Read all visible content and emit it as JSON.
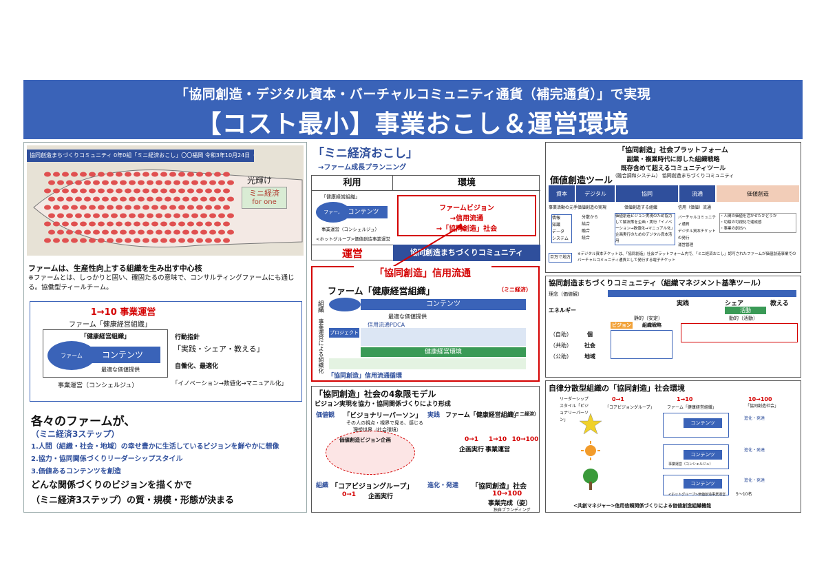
{
  "header": {
    "line1": "「協同創造・デジタル資本・バーチャルコミュニティ通貨（補完通貨）」で実現",
    "line2": "【コスト最小】事業おこし＆運営環境"
  },
  "left": {
    "caption": "協同創造まちづくりコミュニティ 0年0組「ミニ経済おこし」〇〇福岡 令和3年10月24日（日）",
    "fish_label1": "光輝け",
    "fish_label2": "ミニ経済",
    "fish_label3": "for one",
    "farm_heading": "ファームは、生産性向上する組織を生み出す中心核",
    "farm_note": "※ファームとは、しっかりと固い、確固たるの意味で、コンサルティングファームにも通じる。協働型ティールチーム。",
    "diagram_title": "1→10 事業運営",
    "diagram_sub": "ファーム「健康経営組織」",
    "org_label": "「健康経営組織」",
    "farm_oval": "ファーム",
    "contents": "コンテンツ",
    "value": "最適な価値提供",
    "op": "事業運営（コンシェルジュ）",
    "guide_title": "行動指針",
    "guide_text": "「実践・シェア・教える」",
    "auto_title": "自働化、最適化",
    "auto_text": "「イノベーション→数値化→マニュアル化」",
    "bottom_title": "各々のファームが、",
    "bottom_sub": "（ミニ経済3ステップ）",
    "step1": "1.人間（組織・社会・地域）の幸せ豊かに生活しているビジョンを鮮やかに想像",
    "step2": "2.協力・協同関係づくりリーダーシップスタイル",
    "step3": "3.価値あるコンテンツを創造",
    "conclude1": "どんな関係づくりのビジョンを描くかで",
    "conclude2": "（ミニ経済3ステップ）の質・規模・形態が決まる"
  },
  "middle": {
    "title": "「ミニ経済おこし」",
    "subtitle": "→ファーム成長プランニング",
    "col_use": "利用",
    "col_env": "環境",
    "farm": "ファーム",
    "contents": "コンテンツ",
    "org": "「健康経営組織」",
    "op": "事業運営（コンシェルジュ）",
    "hot": "<ホットグループ>価値創造事業運営",
    "vision1": "ファームビジョン",
    "vision2": "→信用流通",
    "vision3": "→「協同創造」社会",
    "unei": "運営",
    "community": "協同創造まちづくりコミュニティ",
    "credit_title": "「協同創造」信用流通",
    "credit_farm": "ファーム「健康経営組織」",
    "credit_mini": "（ミニ経済）",
    "side_label": "組織",
    "side_label2": "事業運営による組織化",
    "credit_contents": "コンテンツ",
    "credit_value": "最適な価値提供",
    "credit_pdca": "信用流通PDCA",
    "credit_project": "プロジェクト",
    "credit_env": "健康経営環境",
    "credit_foot": "「協同創造」信用流通循環",
    "model_title": "「協同創造」社会の4象限モデル",
    "model_sub": "ビジョン実現を協力・協同関係づくりにより形成",
    "q1_label": "価値観",
    "q1_title": "「ビジョナリーパーソン」",
    "q1_text1": "その人の視点・視界で見る、感じる",
    "q1_text2": "理想世界（社会環境）",
    "q2_label": "実践",
    "q2_title": "ファーム「健康経営組織」",
    "q2_mini": "（ミニ経済）",
    "q3_label": "組織",
    "q3_title": "「コアビジョングループ」",
    "q4_label": "進化・発達",
    "q4_title": "「協同創造」社会",
    "vision_plan": "価値創造ビジョン企画",
    "s1": "0→1",
    "s1b": "企画実行",
    "s2": "1→10",
    "s2b": "事業運営",
    "s3": "10→100",
    "s3b": "事業完成（姿）",
    "s3c": "独自ブランディング"
  },
  "right": {
    "platform_title": "「協同創造」社会プラットフォーム",
    "platform_sub1": "副業・複業時代に即した組織戦略",
    "platform_sub2": "既存含めて超えるコミュニティツール",
    "platform_sub3": "（融合調和システム） 協同創造まちづくりコミュニティ",
    "tool_title": "価値創造ツール",
    "tool_cols": [
      "資本",
      "デジタル",
      "協同",
      "流通",
      "価値創造"
    ],
    "tool_r1": [
      "事業活動の元手",
      "価値創造の実現",
      "価値創造する組織",
      "信用（価値）流通",
      ""
    ],
    "tool_cell1": "情報\n知識\nデータ\nシステム",
    "tool_cell2": "分散から\n結合\n融合\n統合",
    "tool_cell3": "価値創造ビジョン実現のため協力して解決策を企画・実行「イノベーション→数値化→マニュアル化」企画実行のためのデジタル資本活用",
    "tool_cell4": "バーチャルコミュニティ通貨\nデジタル資本チケットの発行\n運営管理",
    "tool_cell5": "・人間の価値を活かせたかどうか\n・功績の可視化で達成感\n・事業の創出へ",
    "tool_foot_label": "巨万で地方",
    "tool_foot": "※デジタル資本チケットは、「協同創造」社会プラットフォーム内で、「ミニ経済おこし」認可されたファームが価値創造事業でのバーチャルコミュニティ通貨として発行する電子チケット",
    "community_title": "協同創造まちづくりコミュニティ（組織マネジメント基準ツール）",
    "comm_r1": "理念（価値観）",
    "comm_r2": "エネルギー",
    "comm_practice": "実践",
    "comm_share": "シェア",
    "comm_teach": "教える",
    "comm_act": "活動",
    "comm_still": "静的（安定）",
    "comm_move": "動的（活動）",
    "comm_vision": "ビジョン",
    "comm_strategy": "組織戦略",
    "comm_tags": [
      "（自助）",
      "（共助）",
      "（公助）"
    ],
    "comm_nodes": [
      "個",
      "社会",
      "地域"
    ],
    "auto_title": "自律分散型組織の「協同創造」社会環境",
    "auto_leader": "リーダーシップスタイル「ビジョナリーパーソン」",
    "auto_s1": "0→1",
    "auto_core": "「コアビジョングループ」",
    "auto_s2": "1→10",
    "auto_farm": "ファーム「健康経営組織」",
    "auto_contents": "コンテンツ",
    "auto_op": "事業運営（コンシェルジュ）",
    "auto_s3": "10→100",
    "auto_social": "「協同創造社会」",
    "auto_evo": "進化・発達",
    "auto_hot": "<ホットグループ>価値創造事業運営",
    "auto_count": "5〜10名",
    "auto_foot": "<共創マネジャー>信用信頼関係づくりによる価値創造組織機能"
  },
  "colors": {
    "brand": "#3a63b8",
    "navy": "#2f4f9c",
    "red": "#d40000",
    "green": "#2e9a3a"
  }
}
